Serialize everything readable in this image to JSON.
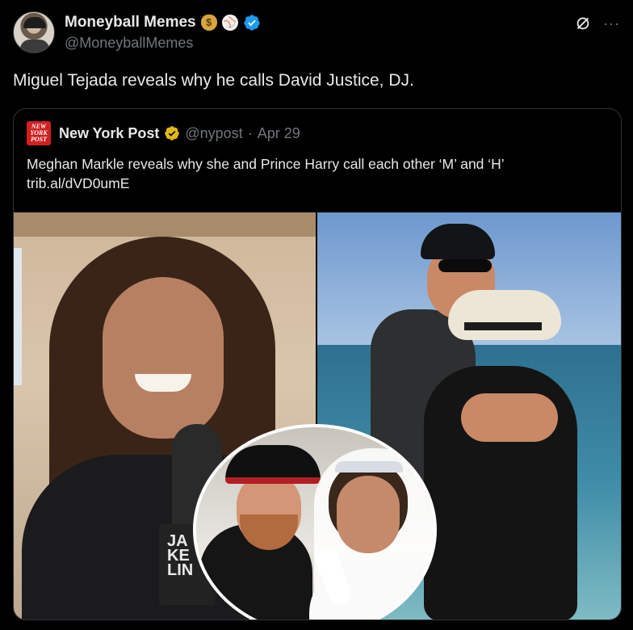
{
  "author": {
    "display_name": "Moneyball Memes",
    "handle": "@MoneyballMemes",
    "badges": [
      "money-bag-emoji",
      "baseball-emoji",
      "verified-blue"
    ]
  },
  "header_icons": {
    "grok": "grok-icon",
    "more": "···"
  },
  "tweet": {
    "text": "Miguel Tejada reveals why he calls David Justice, DJ."
  },
  "quote": {
    "source_logo_text": "NEW YORK POST",
    "name": "New York Post",
    "handle": "@nypost",
    "separator": "·",
    "date": "Apr 29",
    "text": "Meghan Markle reveals why she and Prince Harry call each other ‘M’ and ‘H’",
    "link": "trib.al/dVD0umE"
  },
  "media": {
    "mic_tag": "JA\nKE\nLIN"
  },
  "colors": {
    "background": "#000000",
    "text": "#e7e9ea",
    "muted": "#71767b",
    "border": "#2f3336",
    "verified_blue": "#1d9bf0",
    "gold_check": "#e2b719",
    "nyp_red": "#d21f1f"
  }
}
